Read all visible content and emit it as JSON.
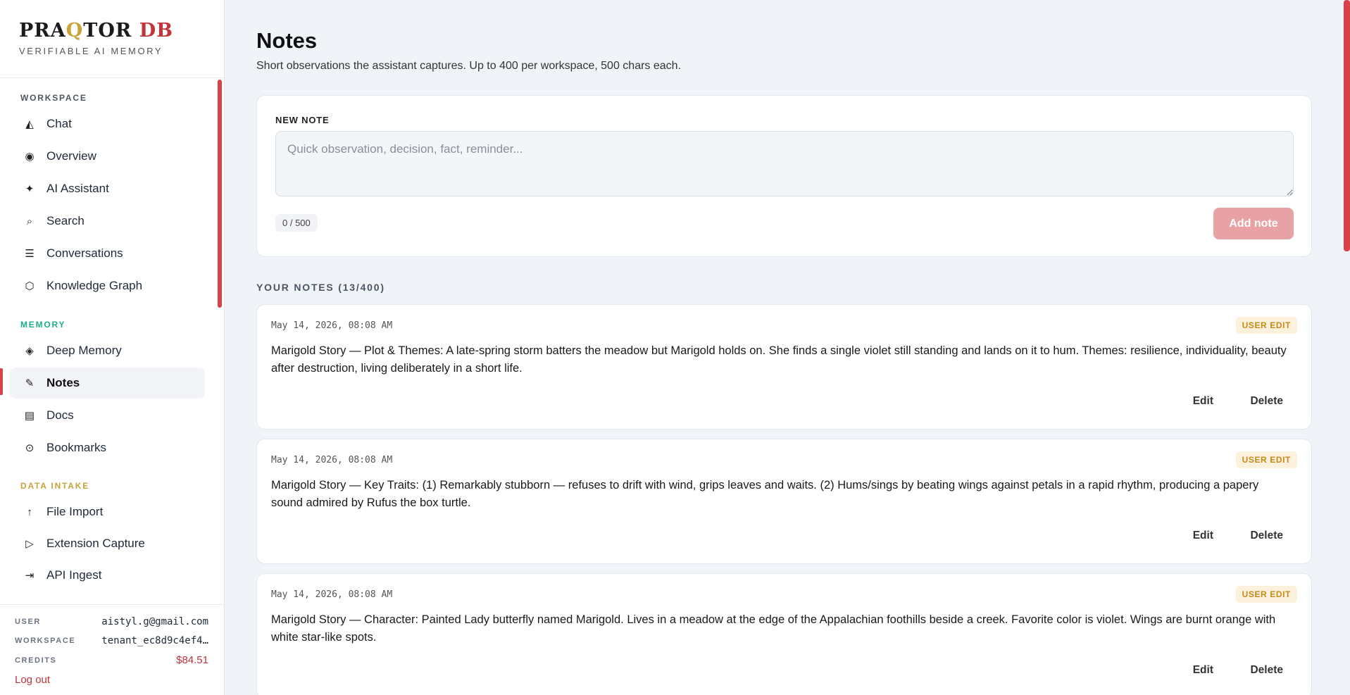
{
  "brand": {
    "title_a": "PRA",
    "title_q": "Q",
    "title_b": "TOR",
    "title_db": "DB",
    "subtitle": "VERIFIABLE AI MEMORY"
  },
  "sidebar": {
    "workspace_label": "WORKSPACE",
    "memory_label": "MEMORY",
    "data_intake_label": "DATA INTAKE",
    "workspace_items": [
      {
        "label": "Chat",
        "icon": "sail-icon"
      },
      {
        "label": "Overview",
        "icon": "target-icon"
      },
      {
        "label": "AI Assistant",
        "icon": "sparkle-icon"
      },
      {
        "label": "Search",
        "icon": "search-icon"
      },
      {
        "label": "Conversations",
        "icon": "list-icon"
      },
      {
        "label": "Knowledge Graph",
        "icon": "hexagon-icon"
      }
    ],
    "memory_items": [
      {
        "label": "Deep Memory",
        "icon": "diamond-icon"
      },
      {
        "label": "Notes",
        "icon": "pen-icon"
      },
      {
        "label": "Docs",
        "icon": "doc-icon"
      },
      {
        "label": "Bookmarks",
        "icon": "clock-icon"
      }
    ],
    "intake_items": [
      {
        "label": "File Import",
        "icon": "arrow-up-icon"
      },
      {
        "label": "Extension Capture",
        "icon": "play-icon"
      },
      {
        "label": "API Ingest",
        "icon": "arrow-into-icon"
      }
    ],
    "colors": {
      "memory": "#1fae8c",
      "data_intake": "#c9a23a",
      "workspace": "#4b5563"
    }
  },
  "footer": {
    "user_label": "USER",
    "user_value": "aistyl.g@gmail.com",
    "workspace_label": "WORKSPACE",
    "workspace_value": "tenant_ec8d9c4ef4…",
    "credits_label": "CREDITS",
    "credits_value": "$84.51",
    "logout": "Log out"
  },
  "main": {
    "title": "Notes",
    "subtitle": "Short observations the assistant captures. Up to 400 per workspace, 500 chars each.",
    "new_note_label": "NEW NOTE",
    "placeholder": "Quick observation, decision, fact, reminder...",
    "counter": "0 / 500",
    "add_button": "Add note",
    "notes_heading": "YOUR NOTES (13/400)"
  },
  "notes": [
    {
      "timestamp": "May 14, 2026, 08:08 AM",
      "badge": "USER EDIT",
      "text": "Marigold Story — Plot & Themes: A late-spring storm batters the meadow but Marigold holds on. She finds a single violet still standing and lands on it to hum. Themes: resilience, individuality, beauty after destruction, living deliberately in a short life.",
      "edit": "Edit",
      "delete": "Delete"
    },
    {
      "timestamp": "May 14, 2026, 08:08 AM",
      "badge": "USER EDIT",
      "text": "Marigold Story — Key Traits: (1) Remarkably stubborn — refuses to drift with wind, grips leaves and waits. (2) Hums/sings by beating wings against petals in a rapid rhythm, producing a papery sound admired by Rufus the box turtle.",
      "edit": "Edit",
      "delete": "Delete"
    },
    {
      "timestamp": "May 14, 2026, 08:08 AM",
      "badge": "USER EDIT",
      "text": "Marigold Story — Character: Painted Lady butterfly named Marigold. Lives in a meadow at the edge of the Appalachian foothills beside a creek. Favorite color is violet. Wings are burnt orange with white star-like spots.",
      "edit": "Edit",
      "delete": "Delete"
    }
  ]
}
